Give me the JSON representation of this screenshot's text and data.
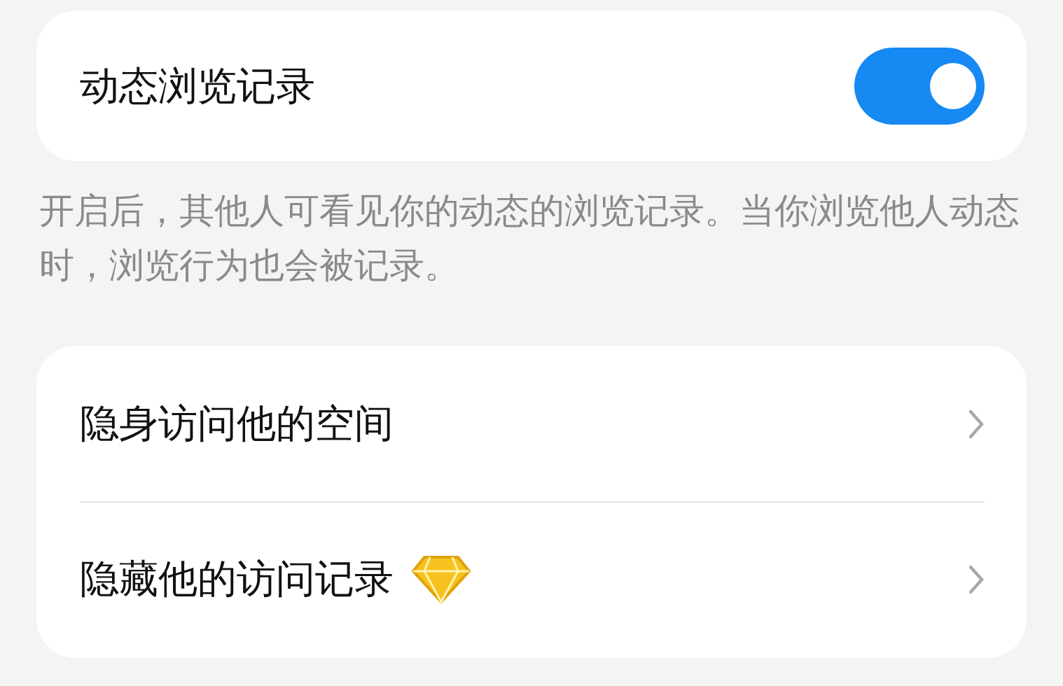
{
  "dynamic_browsing": {
    "label": "动态浏览记录",
    "on": true
  },
  "description": "开启后，其他人可看见你的动态的浏览记录。当你浏览他人动态时，浏览行为也会被记录。",
  "items": [
    {
      "label": "隐身访问他的空间",
      "kind": "plain"
    },
    {
      "label": "隐藏他的访问记录",
      "kind": "premium"
    }
  ]
}
